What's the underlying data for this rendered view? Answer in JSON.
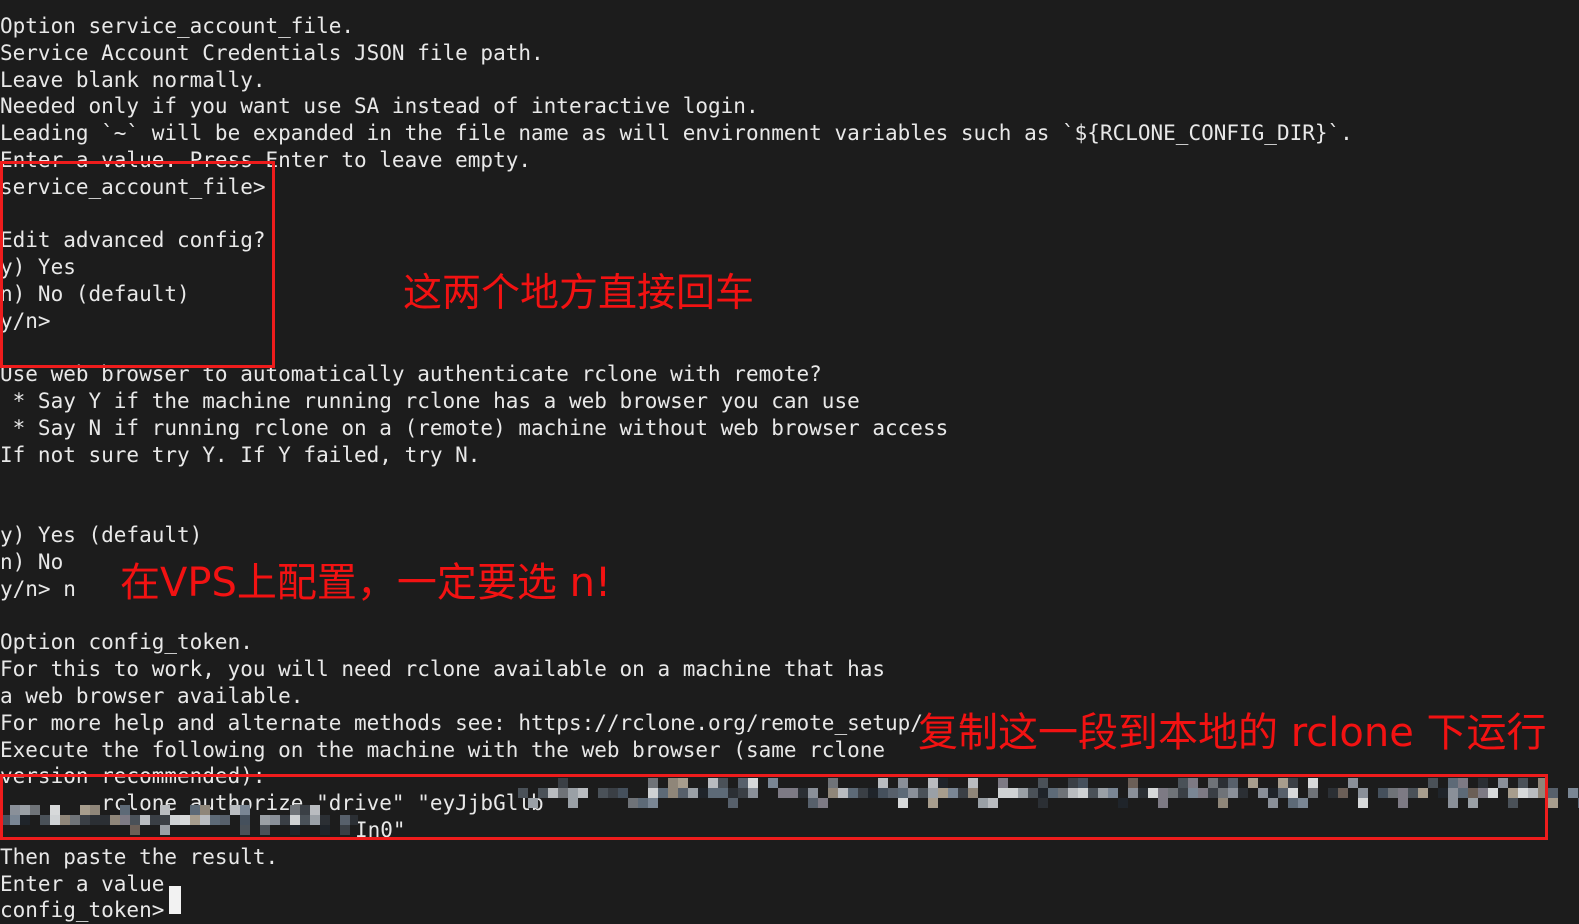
{
  "terminal": {
    "background_color": "#1c1c1c",
    "text_color": "#e8e8e8",
    "prompt_cursor": "block",
    "lines": [
      "Option service_account_file.",
      "Service Account Credentials JSON file path.",
      "Leave blank normally.",
      "Needed only if you want use SA instead of interactive login.",
      "Leading `~` will be expanded in the file name as will environment variables such as `${RCLONE_CONFIG_DIR}`.",
      "Enter a value. Press Enter to leave empty.",
      "service_account_file>",
      "",
      "Edit advanced config?",
      "y) Yes",
      "n) No (default)",
      "y/n>",
      "",
      "Use web browser to automatically authenticate rclone with remote?",
      " * Say Y if the machine running rclone has a web browser you can use",
      " * Say N if running rclone on a (remote) machine without web browser access",
      "If not sure try Y. If Y failed, try N.",
      "",
      "",
      "y) Yes (default)",
      "n) No",
      "y/n> n",
      "",
      "Option config_token.",
      "For this to work, you will need rclone available on a machine that has",
      "a web browser available.",
      "For more help and alternate methods see: https://rclone.org/remote_setup/",
      "Execute the following on the machine with the web browser (same rclone",
      "version recommended):",
      "        rclone authorize \"drive\" \"eyJjbGllb",
      "In0\"",
      "Then paste the result.",
      "Enter a value.",
      "config_token>"
    ]
  },
  "annotations": {
    "color": "#f21212",
    "items": [
      {
        "id": "annot-1",
        "text": "这两个地方直接回车"
      },
      {
        "id": "annot-2",
        "text": "在VPS上配置，一定要选 n!"
      },
      {
        "id": "annot-3",
        "text": "复制这一段到本地的 rclone 下运行"
      }
    ],
    "boxes": [
      {
        "id": "redbox-1",
        "label": "highlight-box-press-enter"
      },
      {
        "id": "redbox-2",
        "label": "highlight-box-authorize-command"
      }
    ]
  },
  "redaction": {
    "style": "mosaic",
    "note": "blurred token text"
  }
}
